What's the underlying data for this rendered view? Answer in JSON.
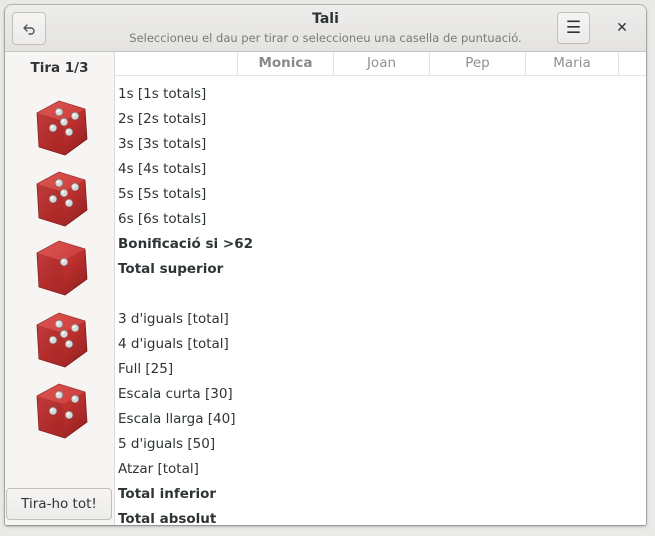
{
  "window": {
    "title": "Tali",
    "subtitle": "Seleccioneu el dau per tirar o seleccioneu una casella de puntuació."
  },
  "sidebar": {
    "roll_label": "Tira 1/3",
    "roll_button": "Tira-ho tot!",
    "dice": [
      {
        "value": 5
      },
      {
        "value": 5
      },
      {
        "value": 1
      },
      {
        "value": 5
      },
      {
        "value": 4
      }
    ]
  },
  "players": [
    "Monica",
    "Joan",
    "Pep",
    "Maria"
  ],
  "rows": [
    {
      "label": "1s [1s totals]",
      "bold": false
    },
    {
      "label": "2s [2s totals]",
      "bold": false
    },
    {
      "label": "3s [3s totals]",
      "bold": false
    },
    {
      "label": "4s [4s totals]",
      "bold": false
    },
    {
      "label": "5s [5s totals]",
      "bold": false
    },
    {
      "label": "6s [6s totals]",
      "bold": false
    },
    {
      "label": "Bonificació si >62",
      "bold": true
    },
    {
      "label": "Total superior",
      "bold": true
    },
    {
      "label": "",
      "bold": false
    },
    {
      "label": "3 d'iguals [total]",
      "bold": false
    },
    {
      "label": "4 d'iguals [total]",
      "bold": false
    },
    {
      "label": "Full [25]",
      "bold": false
    },
    {
      "label": "Escala curta [30]",
      "bold": false
    },
    {
      "label": "Escala llarga [40]",
      "bold": false
    },
    {
      "label": "5 d'iguals [50]",
      "bold": false
    },
    {
      "label": "Atzar [total]",
      "bold": false
    },
    {
      "label": "Total inferior",
      "bold": true
    },
    {
      "label": "Total absolut",
      "bold": true
    }
  ],
  "colors": {
    "die_red": "#c0312f",
    "pip": "#d8d8d8"
  }
}
